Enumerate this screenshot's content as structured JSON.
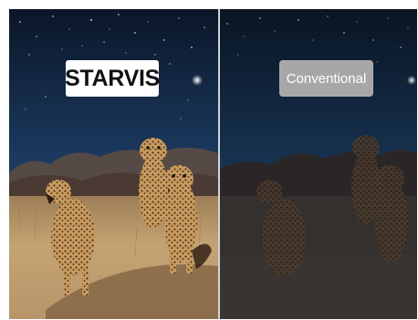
{
  "comparison": {
    "left_label": "STARVIS",
    "right_label": "Conventional"
  },
  "colors": {
    "sky_top": "#0a1424",
    "sky_bottom": "#234a75",
    "grass": "#b99668",
    "label_bg_left": "#ffffff",
    "label_bg_right": "#a7a7a7"
  }
}
